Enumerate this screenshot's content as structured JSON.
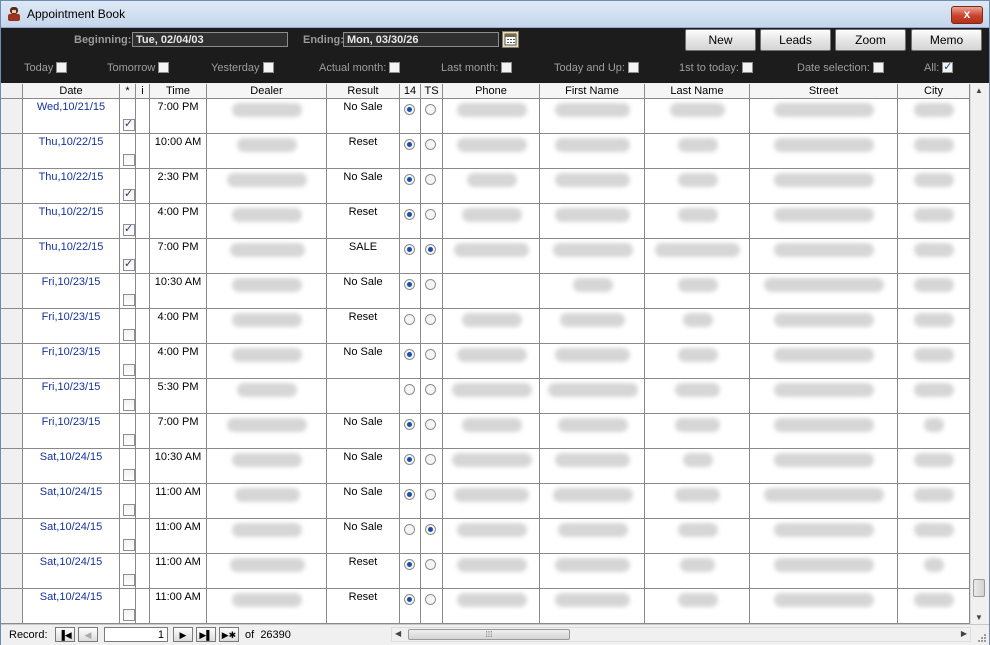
{
  "window": {
    "title": "Appointment Book",
    "close_label": "x"
  },
  "header": {
    "beginning_label": "Beginning:",
    "beginning_value": "Tue, 02/04/03",
    "ending_label": "Ending:",
    "ending_value": "Mon, 03/30/26",
    "buttons": {
      "new": "New",
      "leads": "Leads",
      "zoom": "Zoom",
      "memo": "Memo"
    }
  },
  "filters": [
    {
      "label": "Today",
      "checked": false
    },
    {
      "label": "Tomorrow",
      "checked": false
    },
    {
      "label": "Yesterday",
      "checked": false
    },
    {
      "label": "Actual month:",
      "checked": false
    },
    {
      "label": "Last month:",
      "checked": false
    },
    {
      "label": "Today and Up:",
      "checked": false
    },
    {
      "label": "1st to today:",
      "checked": false
    },
    {
      "label": "Date selection:",
      "checked": false
    },
    {
      "label": "All:",
      "checked": true
    }
  ],
  "columns": [
    "Date",
    "*",
    "i",
    "Time",
    "Dealer",
    "Result",
    "14",
    "TS",
    "Phone",
    "First Name",
    "Last Name",
    "Street",
    "City"
  ],
  "rows": [
    {
      "date": "Wed,10/21/15",
      "star": true,
      "time": "7:00 PM",
      "result": "No Sale",
      "r14": true,
      "ts": false
    },
    {
      "date": "Thu,10/22/15",
      "star": false,
      "time": "10:00 AM",
      "result": "Reset",
      "r14": true,
      "ts": false
    },
    {
      "date": "Thu,10/22/15",
      "star": true,
      "time": "2:30 PM",
      "result": "No Sale",
      "r14": true,
      "ts": false
    },
    {
      "date": "Thu,10/22/15",
      "star": true,
      "time": "4:00 PM",
      "result": "Reset",
      "r14": true,
      "ts": false
    },
    {
      "date": "Thu,10/22/15",
      "star": true,
      "time": "7:00 PM",
      "result": "SALE",
      "r14": true,
      "ts": true
    },
    {
      "date": "Fri,10/23/15",
      "star": false,
      "time": "10:30 AM",
      "result": "No Sale",
      "r14": true,
      "ts": false
    },
    {
      "date": "Fri,10/23/15",
      "star": false,
      "time": "4:00 PM",
      "result": "Reset",
      "r14": false,
      "ts": false
    },
    {
      "date": "Fri,10/23/15",
      "star": false,
      "time": "4:00 PM",
      "result": "No Sale",
      "r14": true,
      "ts": false
    },
    {
      "date": "Fri,10/23/15",
      "star": false,
      "time": "5:30 PM",
      "result": "",
      "r14": false,
      "ts": false
    },
    {
      "date": "Fri,10/23/15",
      "star": false,
      "time": "7:00 PM",
      "result": "No Sale",
      "r14": true,
      "ts": false
    },
    {
      "date": "Sat,10/24/15",
      "star": false,
      "time": "10:30 AM",
      "result": "No Sale",
      "r14": true,
      "ts": false
    },
    {
      "date": "Sat,10/24/15",
      "star": false,
      "time": "11:00 AM",
      "result": "No Sale",
      "r14": true,
      "ts": false
    },
    {
      "date": "Sat,10/24/15",
      "star": false,
      "time": "11:00 AM",
      "result": "No Sale",
      "r14": false,
      "ts": true
    },
    {
      "date": "Sat,10/24/15",
      "star": false,
      "time": "11:00 AM",
      "result": "Reset",
      "r14": true,
      "ts": false
    },
    {
      "date": "Sat,10/24/15",
      "star": false,
      "time": "11:00 AM",
      "result": "Reset",
      "r14": true,
      "ts": false
    }
  ],
  "status": {
    "record_label": "Record:",
    "current_record": "1",
    "of_label": "of",
    "total_records": "26390"
  },
  "colors": {
    "header_bg": "#1c1c1c",
    "date_text": "#15329e",
    "radio_on": "#1c4ea8"
  }
}
